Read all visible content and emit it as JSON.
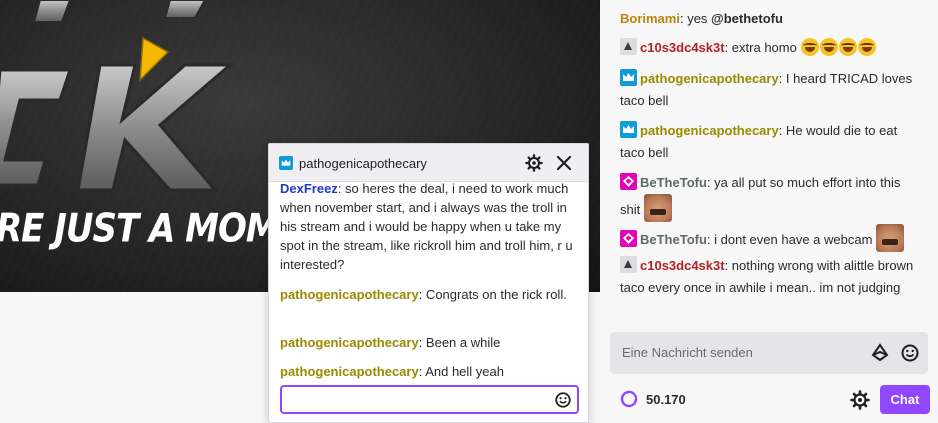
{
  "video": {
    "logo_text": "CK",
    "overlay_text": "RE JUST A MOMENT",
    "colors": {
      "accent": "#f5b700",
      "logo_metal": "#9a9a9a"
    }
  },
  "chat": {
    "messages": [
      {
        "user": "Borimami",
        "user_color": "#b8860b",
        "badge": null,
        "text": ": yes ",
        "mention": "@bethetofu"
      },
      {
        "user": "c10s3dc4sk3t",
        "user_color": "#b22222",
        "badge": "moderator",
        "text": ": extra homo",
        "emotes": [
          "face-with-tears-of-joy",
          "face-with-tears-of-joy",
          "face-with-tears-of-joy",
          "face-with-tears-of-joy"
        ]
      },
      {
        "user": "pathogenicapothecary",
        "user_color": "#9a8a00",
        "badge": "crown",
        "text": ": I heard TRICAD loves taco bell"
      },
      {
        "user": "pathogenicapothecary",
        "user_color": "#9a8a00",
        "badge": "crown",
        "text": ": He would die to eat taco bell"
      },
      {
        "user": "BeTheTofu",
        "user_color": "#5f6a6a",
        "badge": "broadcaster",
        "text": ": ya all put so much effort into this shit",
        "emotes": [
          "streamer-face"
        ]
      },
      {
        "user": "BeTheTofu",
        "user_color": "#5f6a6a",
        "badge": "broadcaster",
        "text": ": i dont even have a webcam",
        "emotes": [
          "streamer-face"
        ]
      },
      {
        "user": "c10s3dc4sk3t",
        "user_color": "#b22222",
        "badge": "moderator",
        "text": ": nothing wrong with alittle brown taco every once in awhile i mean.. im not judging"
      }
    ],
    "input_placeholder": "Eine Nachricht senden",
    "points_value": "50.170",
    "chat_button_label": "Chat",
    "accent_color": "#9147ff"
  },
  "whisper": {
    "title": "pathogenicapothecary",
    "messages": [
      {
        "user": "DexFreez",
        "user_color": "#1e3cc8",
        "text": ": so heres the deal, i need to work much when november start, and i always was the troll in his stream and i would be happy when u take my spot in the stream, like rickroll him and troll him, r u interested?"
      },
      {
        "user": "pathogenicapothecary",
        "user_color": "#9a8a00",
        "text": ": Congrats on the rick roll."
      },
      {
        "user": "pathogenicapothecary",
        "user_color": "#9a8a00",
        "text": ": Been a while"
      },
      {
        "user": "pathogenicapothecary",
        "user_color": "#9a8a00",
        "text": ": And hell yeah"
      }
    ],
    "input_value": ""
  }
}
